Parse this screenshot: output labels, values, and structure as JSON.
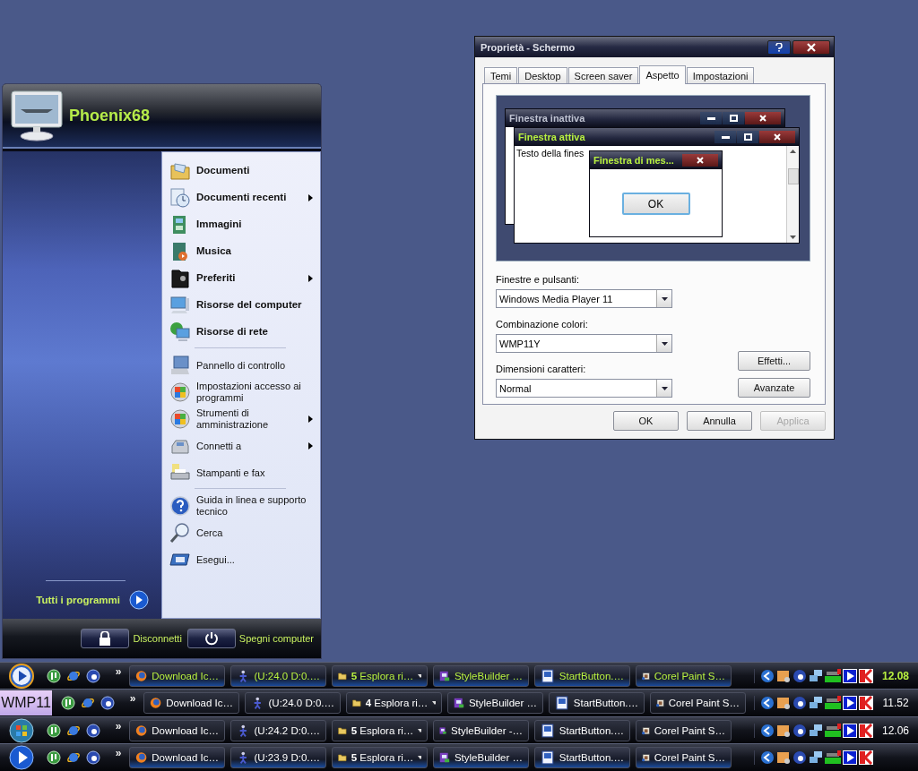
{
  "start_menu": {
    "user": "Phoenix68",
    "items": [
      {
        "kind": "item",
        "label": "Documenti",
        "bold": true,
        "submenu": false
      },
      {
        "kind": "item",
        "label": "Documenti recenti",
        "bold": true,
        "submenu": true
      },
      {
        "kind": "item",
        "label": "Immagini",
        "bold": true,
        "submenu": false
      },
      {
        "kind": "item",
        "label": "Musica",
        "bold": true,
        "submenu": false
      },
      {
        "kind": "item",
        "label": "Preferiti",
        "bold": true,
        "submenu": true
      },
      {
        "kind": "item",
        "label": "Risorse del computer",
        "bold": true,
        "submenu": false
      },
      {
        "kind": "item",
        "label": "Risorse di rete",
        "bold": true,
        "submenu": false
      },
      {
        "kind": "separator"
      },
      {
        "kind": "item",
        "label": "Pannello di controllo",
        "bold": false,
        "submenu": false
      },
      {
        "kind": "item",
        "label": "Impostazioni accesso ai programmi",
        "bold": false,
        "submenu": false
      },
      {
        "kind": "item",
        "label": "Strumenti di amministrazione",
        "bold": false,
        "submenu": true
      },
      {
        "kind": "item",
        "label": "Connetti a",
        "bold": false,
        "submenu": true
      },
      {
        "kind": "item",
        "label": "Stampanti e fax",
        "bold": false,
        "submenu": false
      },
      {
        "kind": "separator"
      },
      {
        "kind": "item",
        "label": "Guida in linea e supporto tecnico",
        "bold": false,
        "submenu": false
      },
      {
        "kind": "item",
        "label": "Cerca",
        "bold": false,
        "submenu": false
      },
      {
        "kind": "item",
        "label": "Esegui...",
        "bold": false,
        "submenu": false
      }
    ],
    "all_programs": "Tutti i programmi",
    "footer": [
      {
        "kind": "lock",
        "label": "Disconnetti"
      },
      {
        "kind": "power",
        "label": "Spegni computer"
      }
    ]
  },
  "dialog": {
    "title": "Proprietà - Schermo",
    "tabs": [
      {
        "label": "Temi",
        "selected": false
      },
      {
        "label": "Desktop",
        "selected": false
      },
      {
        "label": "Screen saver",
        "selected": false
      },
      {
        "label": "Aspetto",
        "selected": true
      },
      {
        "label": "Impostazioni",
        "selected": false
      }
    ],
    "preview": {
      "inactive_title": "Finestra inattiva",
      "active_title": "Finestra attiva",
      "window_text": "Testo della fines",
      "message_title": "Finestra di mes...",
      "message_button": "OK"
    },
    "fields": [
      {
        "label": "Finestre e pulsanti:",
        "value": "Windows Media Player 11"
      },
      {
        "label": "Combinazione colori:",
        "value": "WMP11Y"
      },
      {
        "label": "Dimensioni caratteri:",
        "value": "Normal"
      }
    ],
    "side_buttons": [
      "Effetti...",
      "Avanzate"
    ],
    "buttons": [
      {
        "label": "OK",
        "disabled": false
      },
      {
        "label": "Annulla",
        "disabled": false
      },
      {
        "label": "Applica",
        "disabled": true
      }
    ]
  },
  "taskbars": [
    {
      "start": {
        "kind": "wmp"
      },
      "glow": true,
      "accent": true,
      "chevron": "»",
      "tasks": [
        {
          "label": "Download Ic…",
          "dropdown": false
        },
        {
          "label": "(U:24.0 D:0.…",
          "dropdown": false
        },
        {
          "label": "**5** Esplora ri…",
          "dropdown": true
        },
        {
          "label": "StyleBuilder …",
          "dropdown": false
        },
        {
          "label": "StartButton.…",
          "dropdown": false
        },
        {
          "label": "Corel Paint S…",
          "dropdown": false
        }
      ],
      "clock": "12.08"
    },
    {
      "start": {
        "kind": "text",
        "label": "WMP11"
      },
      "glow": false,
      "accent": false,
      "chevron": "»",
      "tasks": [
        {
          "label": "Download Ic…",
          "dropdown": false
        },
        {
          "label": "(U:24.0 D:0.…",
          "dropdown": false
        },
        {
          "label": "**4** Esplora ri…",
          "dropdown": true
        },
        {
          "label": "StyleBuilder …",
          "dropdown": false
        },
        {
          "label": "StartButton.…",
          "dropdown": false
        },
        {
          "label": "Corel Paint S…",
          "dropdown": false
        }
      ],
      "clock": "11.52"
    },
    {
      "start": {
        "kind": "windows"
      },
      "glow": false,
      "accent": false,
      "chevron": "»",
      "tasks": [
        {
          "label": "Download Ic…",
          "dropdown": false
        },
        {
          "label": "(U:24.2 D:0.…",
          "dropdown": false
        },
        {
          "label": "**5** Esplora ri…",
          "dropdown": true
        },
        {
          "label": "StyleBuilder -…",
          "dropdown": false
        },
        {
          "label": "StartButton.…",
          "dropdown": false
        },
        {
          "label": "Corel Paint S…",
          "dropdown": false
        }
      ],
      "clock": "12.06"
    },
    {
      "start": {
        "kind": "play"
      },
      "glow": true,
      "accent": false,
      "chevron": "»",
      "tasks": [
        {
          "label": "Download Ic…",
          "dropdown": false
        },
        {
          "label": "(U:23.9 D:0.…",
          "dropdown": false
        },
        {
          "label": "**5** Esplora ri…",
          "dropdown": true
        },
        {
          "label": "StyleBuilder …",
          "dropdown": false
        },
        {
          "label": "StartButton.…",
          "dropdown": false
        },
        {
          "label": "Corel Paint S…",
          "dropdown": false
        }
      ]
    }
  ]
}
